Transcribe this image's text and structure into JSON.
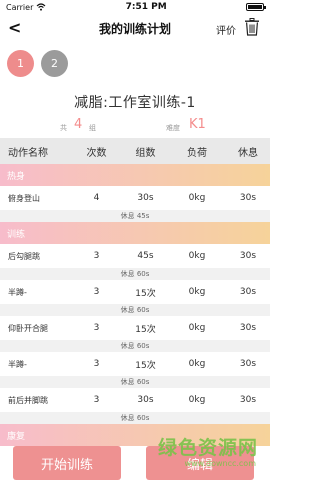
{
  "status_bar": {
    "carrier": "Carrier",
    "time": "7:51 PM"
  },
  "nav": {
    "back_glyph": "<",
    "title": "我的训练计划",
    "rate_label": "评价",
    "trash_icon": "trash-icon"
  },
  "tabs": [
    {
      "label": "1",
      "color": "#ee8c8c"
    },
    {
      "label": "2",
      "color": "#9b9b9b"
    }
  ],
  "plan": {
    "title": "减脂:工作室训练-1",
    "groups_prefix": "共",
    "groups_count": "4",
    "groups_suffix": "组",
    "difficulty_label": "难度",
    "difficulty_value": "K1"
  },
  "table": {
    "headers": [
      "动作名称",
      "次数",
      "组数",
      "负荷",
      "休息"
    ],
    "sections": [
      {
        "name": "热身",
        "rows": [
          {
            "name": "俯身登山",
            "reps": "4",
            "sets": "30s",
            "load": "0kg",
            "rest": "30s",
            "rest_between": "休息 45s"
          }
        ]
      },
      {
        "name": "训练",
        "rows": [
          {
            "name": "后勾腿跳",
            "reps": "3",
            "sets": "45s",
            "load": "0kg",
            "rest": "30s",
            "rest_between": "休息 60s"
          },
          {
            "name": "半蹲-",
            "reps": "3",
            "sets": "15次",
            "load": "0kg",
            "rest": "30s",
            "rest_between": "休息 60s"
          },
          {
            "name": "仰卧开合腿",
            "reps": "3",
            "sets": "15次",
            "load": "0kg",
            "rest": "30s",
            "rest_between": "休息 60s"
          },
          {
            "name": "半蹲-",
            "reps": "3",
            "sets": "15次",
            "load": "0kg",
            "rest": "30s",
            "rest_between": "休息 60s"
          },
          {
            "name": "前后并脚跳",
            "reps": "3",
            "sets": "30s",
            "load": "0kg",
            "rest": "30s",
            "rest_between": "休息 60s"
          }
        ]
      },
      {
        "name": "康复",
        "rows": []
      }
    ]
  },
  "buttons": {
    "start": "开始训练",
    "edit": "编辑"
  },
  "watermark": {
    "main": "绿色资源网",
    "sub": "www.downcc.com"
  },
  "colors": {
    "accent": "#ee8c8c",
    "inactive": "#9b9b9b",
    "section_from": "#f7bccb",
    "section_to": "#f6d39a"
  }
}
